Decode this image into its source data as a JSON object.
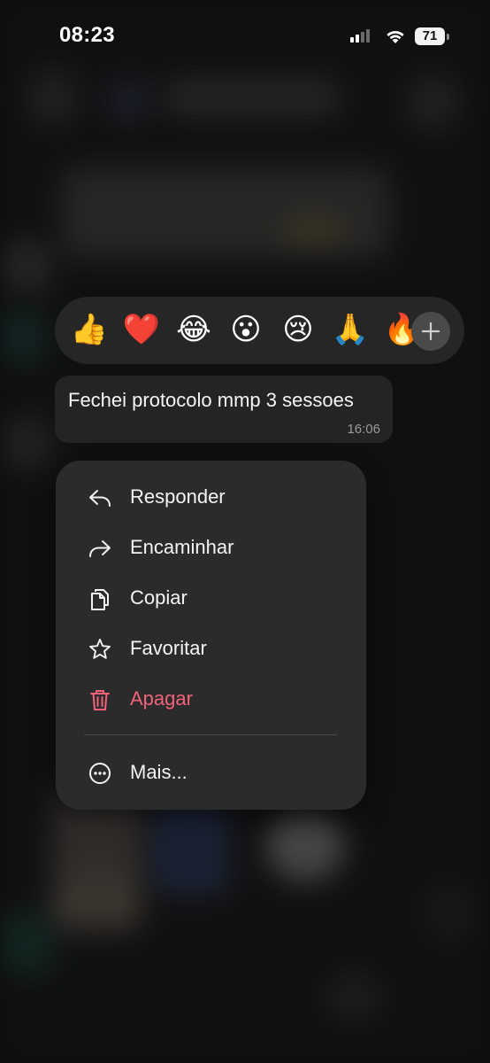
{
  "status_bar": {
    "time": "08:23",
    "battery": "71"
  },
  "reactions": {
    "emojis": [
      "👍",
      "❤️",
      "😂",
      "😮",
      "😢",
      "🙏",
      "🔥"
    ],
    "add_icon": "plus-icon"
  },
  "message": {
    "text": "Fechei protocolo mmp 3 sessoes",
    "time": "16:06"
  },
  "menu": {
    "items": [
      {
        "label": "Responder",
        "icon": "reply-icon"
      },
      {
        "label": "Encaminhar",
        "icon": "forward-icon"
      },
      {
        "label": "Copiar",
        "icon": "copy-icon"
      },
      {
        "label": "Favoritar",
        "icon": "star-icon"
      },
      {
        "label": "Apagar",
        "icon": "trash-icon",
        "color": "#f2627a"
      },
      {
        "label": "Mais...",
        "icon": "more-icon"
      }
    ]
  },
  "colors": {
    "background": "#141414",
    "menu_background": "#2b2b2b",
    "bubble_background": "#242424",
    "danger": "#f2627a"
  }
}
